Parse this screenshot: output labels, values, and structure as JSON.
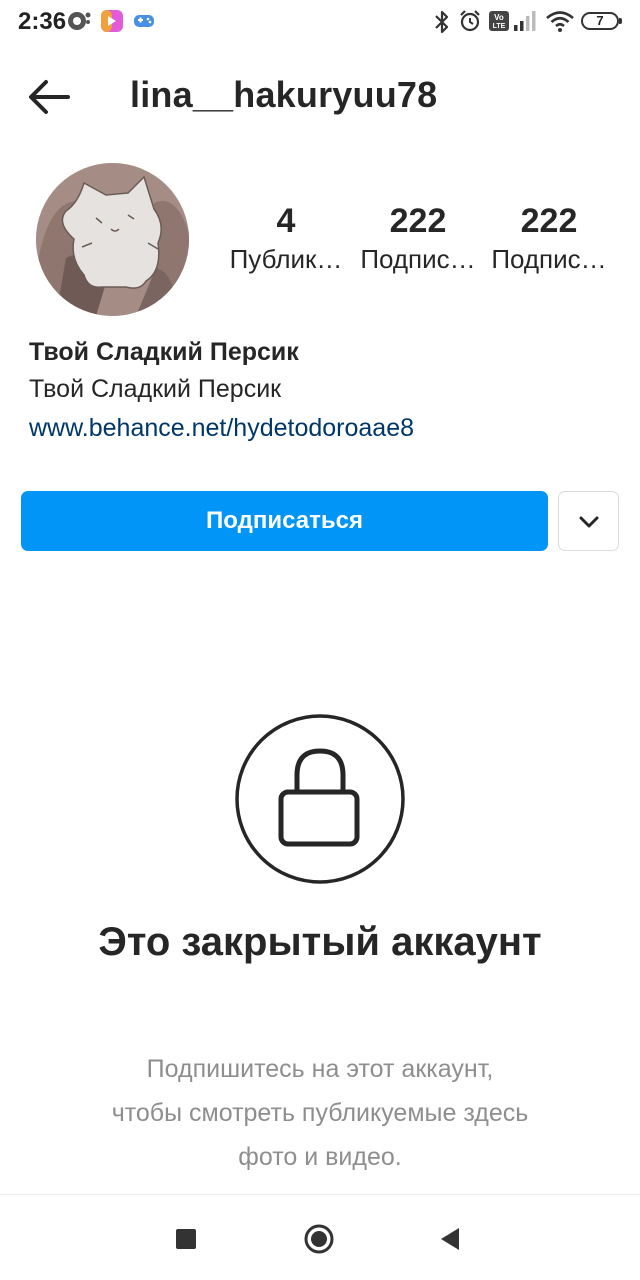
{
  "status_bar": {
    "time": "2:36",
    "battery": "7",
    "icons": [
      "notification-icon",
      "app-icon",
      "game-icon",
      "bluetooth-icon",
      "alarm-icon",
      "volte-icon",
      "signal-icon",
      "wifi-icon",
      "battery-icon"
    ]
  },
  "header": {
    "username": "lina__hakuryuu78",
    "back_icon": "arrow-left-icon"
  },
  "profile": {
    "stats": [
      {
        "count": "4",
        "label": "Публик…"
      },
      {
        "count": "222",
        "label": "Подпис…"
      },
      {
        "count": "222",
        "label": "Подпис…"
      }
    ],
    "name": "Твой Сладкий Персик",
    "bio": "Твой Сладкий Персик",
    "link": "www.behance.net/hydetodoroaae8"
  },
  "actions": {
    "follow_label": "Подписаться",
    "dropdown_icon": "chevron-down-icon"
  },
  "private": {
    "title": "Это закрытый аккаунт",
    "description": "Подпишитесь на этот аккаунт, чтобы смотреть публикуемые здесь фото и видео."
  },
  "colors": {
    "accent": "#0095f6",
    "link": "#00376b",
    "muted": "#8e8e8e",
    "text": "#262626"
  }
}
